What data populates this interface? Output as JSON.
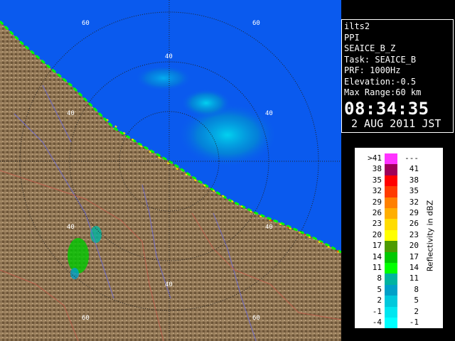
{
  "info": {
    "site": "ilts2",
    "scan_type": "PPI",
    "product": "SEAICE_B_Z",
    "task": "Task: SEAICE_B",
    "prf": "PRF: 1000Hz",
    "elevation": "Elevation:-0.5",
    "max_range": "Max Range:60 km",
    "time": "08:34:35",
    "date": "2 AUG 2011 JST"
  },
  "legend": {
    "title": "Reflectivity in dBZ",
    "rows": [
      {
        "left": ">41",
        "right": "---",
        "color": "#ff33ff"
      },
      {
        "left": "38",
        "right": "41",
        "color": "#a0005a"
      },
      {
        "left": "35",
        "right": "38",
        "color": "#ff0000"
      },
      {
        "left": "32",
        "right": "35",
        "color": "#ff3b00"
      },
      {
        "left": "29",
        "right": "32",
        "color": "#ff8000"
      },
      {
        "left": "26",
        "right": "29",
        "color": "#ffae00"
      },
      {
        "left": "23",
        "right": "26",
        "color": "#ffdc00"
      },
      {
        "left": "20",
        "right": "23",
        "color": "#ffff00"
      },
      {
        "left": "17",
        "right": "20",
        "color": "#4d9b00"
      },
      {
        "left": "14",
        "right": "17",
        "color": "#00c800"
      },
      {
        "left": "11",
        "right": "14",
        "color": "#00ff00"
      },
      {
        "left": "8",
        "right": "11",
        "color": "#00b4a0"
      },
      {
        "left": "5",
        "right": "8",
        "color": "#00a0c8"
      },
      {
        "left": "2",
        "right": "5",
        "color": "#00c8dc"
      },
      {
        "left": "-1",
        "right": "2",
        "color": "#00e6f0"
      },
      {
        "left": "-4",
        "right": "-1",
        "color": "#00ffff"
      }
    ]
  },
  "range_ring_labels": [
    "40",
    "60"
  ],
  "colors": {
    "sea": "#0a5aee",
    "land": "#8c7252",
    "coast_echo": "#00ff00",
    "range_ring": "#222222"
  }
}
